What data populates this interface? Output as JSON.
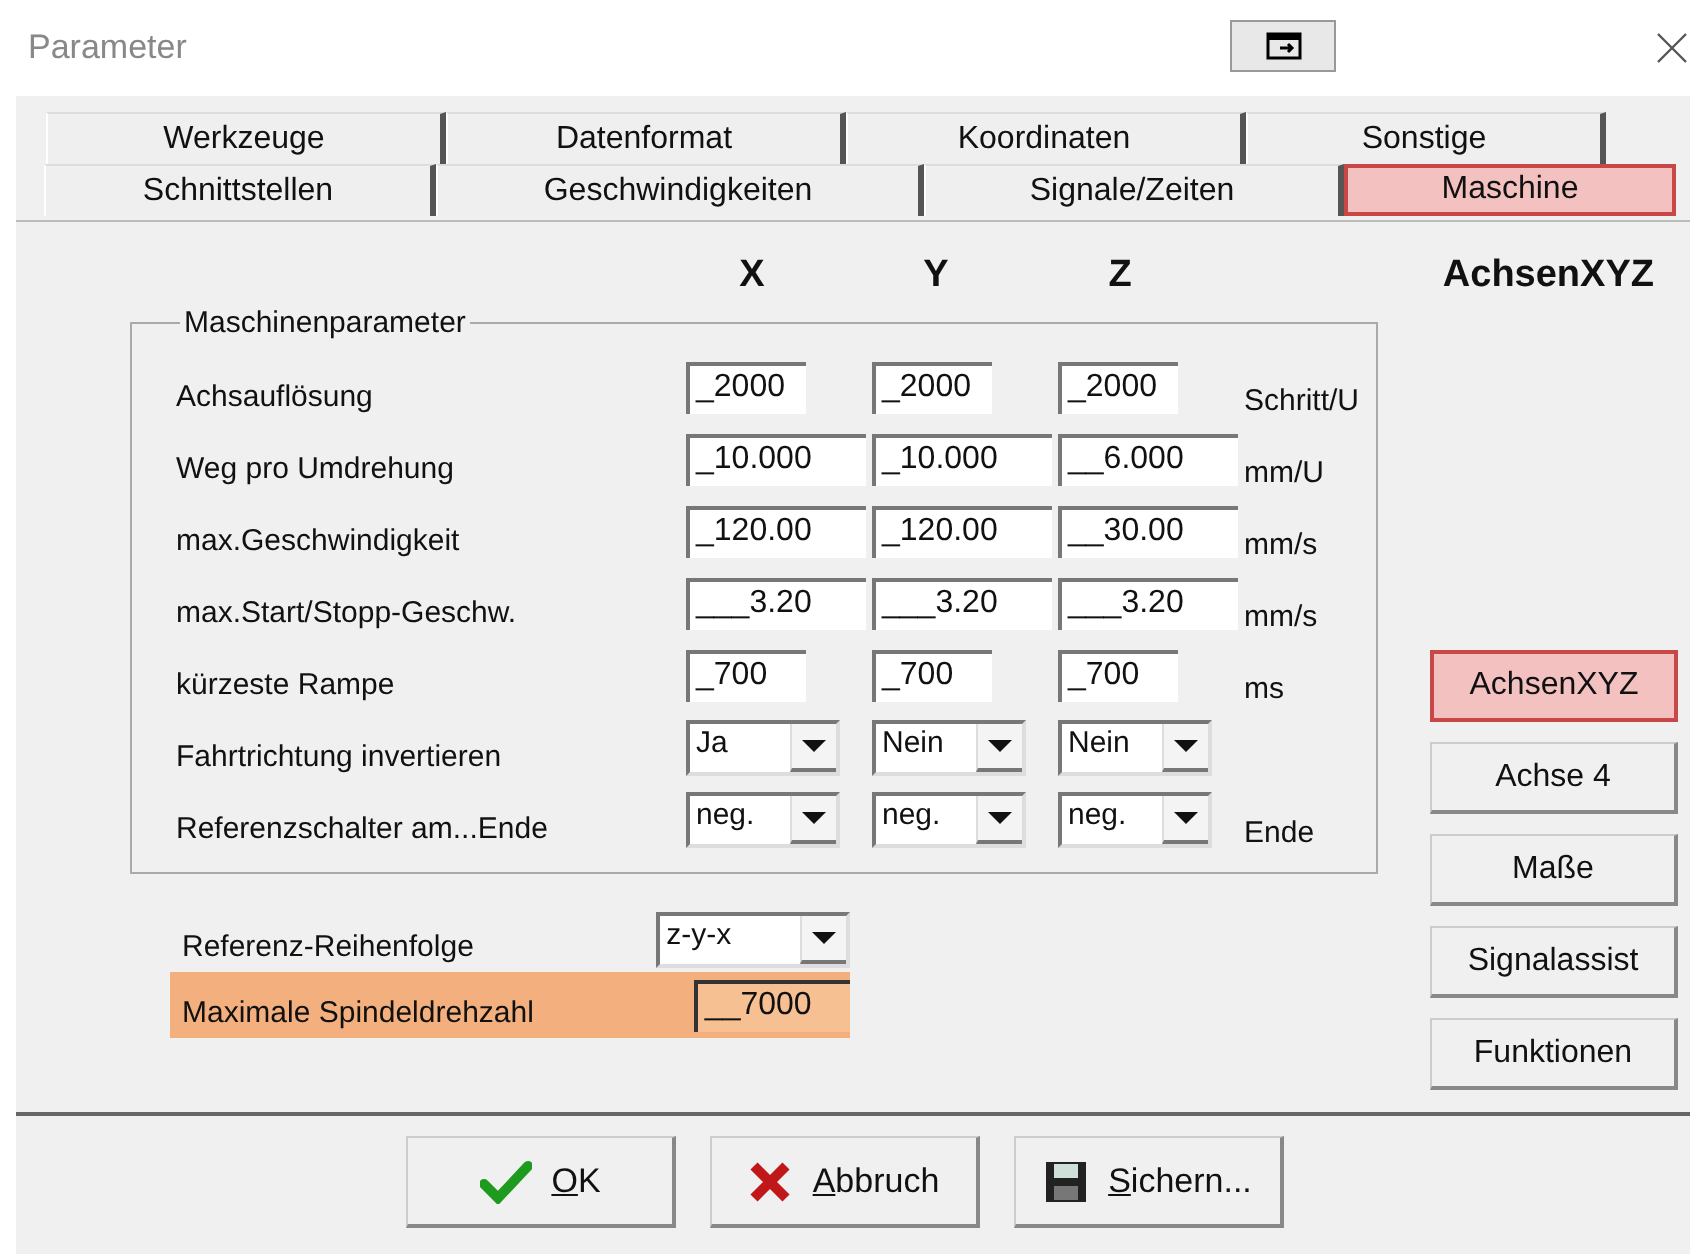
{
  "window": {
    "title": "Parameter"
  },
  "tabs": [
    [
      {
        "label": "Werkzeuge",
        "selected": false
      },
      {
        "label": "Datenformat",
        "selected": false
      },
      {
        "label": "Koordinaten",
        "selected": false
      },
      {
        "label": "Sonstige",
        "selected": false
      }
    ],
    [
      {
        "label": "Schnittstellen",
        "selected": false
      },
      {
        "label": "Geschwindigkeiten",
        "selected": false
      },
      {
        "label": "Signale/Zeiten",
        "selected": false
      },
      {
        "label": "Maschine",
        "selected": true
      }
    ]
  ],
  "axes": [
    "X",
    "Y",
    "Z"
  ],
  "section_title": "AchsenXYZ",
  "group": {
    "title": "Maschinenparameter",
    "rows": [
      {
        "label": "Achsauflösung",
        "kind": "short",
        "values": [
          "_2000",
          "_2000",
          "_2000"
        ],
        "unit": "Schritt/U"
      },
      {
        "label": "Weg pro Umdrehung",
        "kind": "long",
        "values": [
          "_10.000",
          "_10.000",
          "__6.000"
        ],
        "unit": "mm/U"
      },
      {
        "label": "max.Geschwindigkeit",
        "kind": "long",
        "values": [
          "_120.00",
          "_120.00",
          "__30.00"
        ],
        "unit": "mm/s"
      },
      {
        "label": "max.Start/Stopp-Geschw.",
        "kind": "long",
        "values": [
          "___3.20",
          "___3.20",
          "___3.20"
        ],
        "unit": "mm/s"
      },
      {
        "label": "kürzeste Rampe",
        "kind": "short",
        "values": [
          "_700",
          "_700",
          "_700"
        ],
        "unit": "ms"
      },
      {
        "label": "Fahrtrichtung invertieren",
        "kind": "select",
        "values": [
          "Ja",
          "Nein",
          "Nein"
        ]
      },
      {
        "label": "Referenzschalter am...Ende",
        "kind": "select",
        "values": [
          "neg.",
          "neg.",
          "neg."
        ],
        "unit": "Ende"
      }
    ]
  },
  "extra": [
    {
      "label": "Referenz-Reihenfolge",
      "kind": "select",
      "value": "z-y-x",
      "highlighted": false
    },
    {
      "label": "Maximale Spindeldrehzahl",
      "kind": "input",
      "value": "__7000",
      "highlighted": true
    }
  ],
  "side_buttons": [
    {
      "label": "AchsenXYZ",
      "selected": true
    },
    {
      "label": "Achse 4",
      "selected": false
    },
    {
      "label": "Maße",
      "selected": false
    },
    {
      "label": "Signalassist",
      "selected": false
    },
    {
      "label": "Funktionen",
      "selected": false
    }
  ],
  "footer_buttons": [
    {
      "label": "OK",
      "kind": "ok",
      "mnemonic_underlined": true
    },
    {
      "label": "Abbruch",
      "kind": "cancel",
      "mnemonic_underlined": true
    },
    {
      "label": "Sichern...",
      "kind": "save",
      "mnemonic_underlined": true
    }
  ]
}
